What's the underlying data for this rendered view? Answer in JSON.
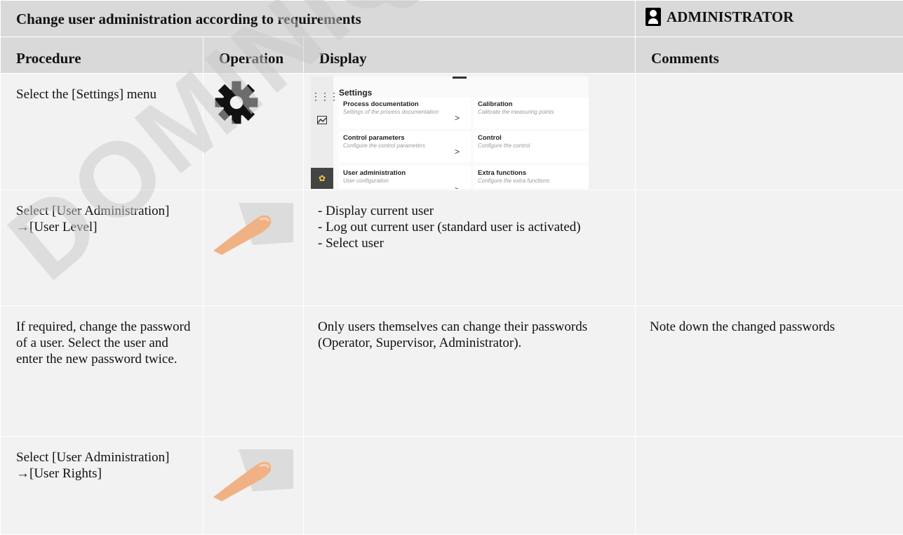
{
  "watermark": "DOMINIQUE DEMAY",
  "header": {
    "title": "Change user administration according to requirements",
    "role": "ADMINISTRATOR",
    "role_icon": "user-icon"
  },
  "columns": [
    "Procedure",
    "Operation",
    "Display",
    "Comments"
  ],
  "rows": [
    {
      "procedure": "Select the [Settings] menu",
      "operation_icon": "gear-icon",
      "display_text": "",
      "comment": ""
    },
    {
      "procedure": "Select [User Administration] →[User Level]",
      "operation_icon": "finger-tap-icon",
      "display_lines": [
        "- Display current user",
        "- Log out current user (standard user is activated)",
        "- Select user"
      ],
      "comment": ""
    },
    {
      "procedure": "If required, change the password of a user. Select the user and enter the new password twice.",
      "operation_icon": "",
      "display_text": "Only users themselves can change their passwords (Operator, Supervisor, Administrator).",
      "comment": "Note down the changed passwords"
    },
    {
      "procedure": "Select [User Administration] →[User Rights]",
      "operation_icon": "finger-tap-icon",
      "display_text": "",
      "comment": ""
    }
  ],
  "settings_screen": {
    "title": "Settings",
    "tiles": [
      {
        "title": "Process documentation",
        "subtitle": "Settings of the process documentation"
      },
      {
        "title": "Calibration",
        "subtitle": "Calibrate the measuring points"
      },
      {
        "title": "Control parameters",
        "subtitle": "Configure the control parameters"
      },
      {
        "title": "Control",
        "subtitle": "Configure the control"
      },
      {
        "title": "User administration",
        "subtitle": "User configuration"
      },
      {
        "title": "Extra functions",
        "subtitle": "Configure the extra functions"
      }
    ],
    "rail_icons": [
      "grid-icon",
      "chart-icon",
      "gear-icon"
    ],
    "accent": "#f5d24a",
    "chevron": ">"
  },
  "colors": {
    "header_bg": "#d9d9d9",
    "body_bg": "#f2f2f2"
  }
}
